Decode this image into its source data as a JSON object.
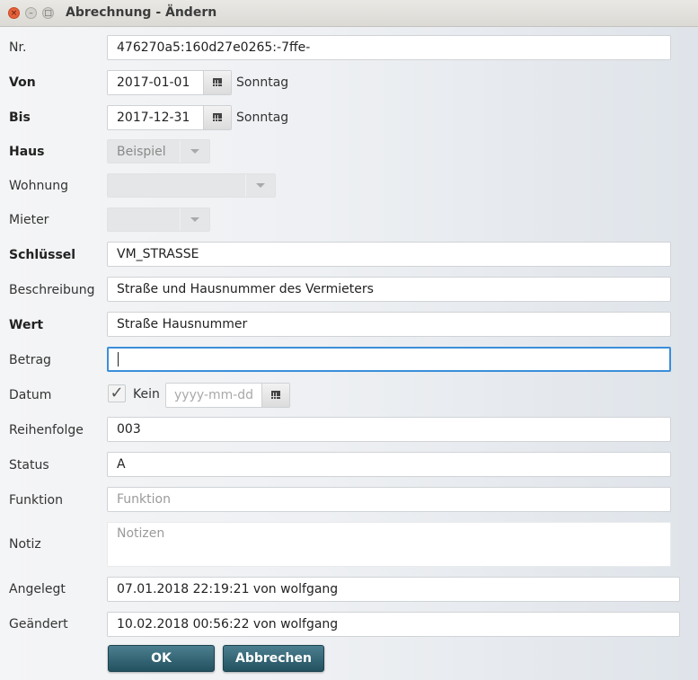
{
  "window": {
    "title": "Abrechnung - Ändern",
    "close_glyph": "×",
    "min_glyph": "–",
    "max_glyph": "□"
  },
  "form": {
    "nr": {
      "label": "Nr.",
      "value": "476270a5:160d27e0265:-7ffe-"
    },
    "von": {
      "label": "Von",
      "value": "2017-01-01",
      "weekday": "Sonntag"
    },
    "bis": {
      "label": "Bis",
      "value": "2017-12-31",
      "weekday": "Sonntag"
    },
    "haus": {
      "label": "Haus",
      "value": "Beispiel"
    },
    "wohnung": {
      "label": "Wohnung",
      "value": ""
    },
    "mieter": {
      "label": "Mieter",
      "value": ""
    },
    "schluessel": {
      "label": "Schlüssel",
      "value": "VM_STRASSE"
    },
    "beschreibung": {
      "label": "Beschreibung",
      "value": "Straße und Hausnummer des Vermieters"
    },
    "wert": {
      "label": "Wert",
      "value": "Straße Hausnummer"
    },
    "betrag": {
      "label": "Betrag",
      "value": ""
    },
    "datum": {
      "label": "Datum",
      "checkbox_label": "Kein",
      "checked": true,
      "check_glyph": "✓",
      "placeholder": "yyyy-mm-dd"
    },
    "reihenfolge": {
      "label": "Reihenfolge",
      "value": "003"
    },
    "status": {
      "label": "Status",
      "value": "A"
    },
    "funktion": {
      "label": "Funktion",
      "placeholder": "Funktion"
    },
    "notiz": {
      "label": "Notiz",
      "placeholder": "Notizen"
    },
    "angelegt": {
      "label": "Angelegt",
      "value": "07.01.2018 22:19:21 von wolfgang"
    },
    "geaendert": {
      "label": "Geändert",
      "value": "10.02.2018 00:56:22 von wolfgang"
    }
  },
  "buttons": {
    "ok": "OK",
    "cancel": "Abbrechen"
  },
  "icons": {
    "calendar": "calendar-icon",
    "dropdown": "chevron-down-icon"
  },
  "colors": {
    "button_top": "#4b7f90",
    "button_bottom": "#23515f",
    "focus_border": "#3b8ed9",
    "close_button": "#e5603a"
  }
}
